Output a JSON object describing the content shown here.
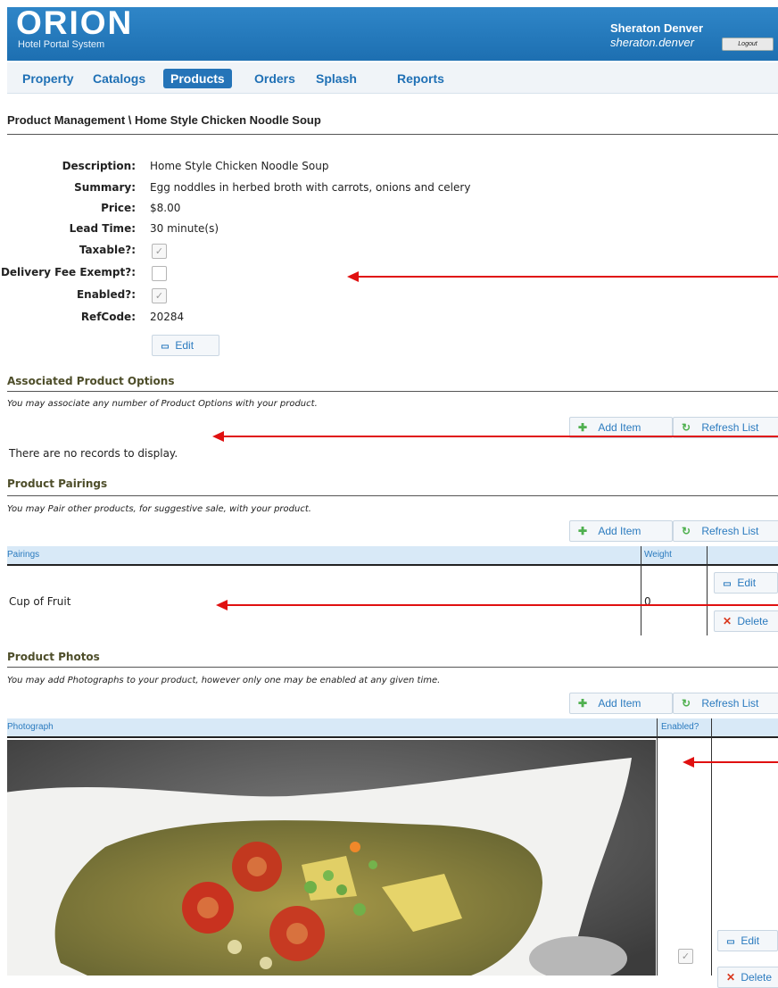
{
  "header": {
    "logo": "ORION",
    "logo_subtitle": "Hotel Portal System",
    "hotel_name": "Sheraton Denver",
    "username": "sheraton.denver",
    "logout_label": "Logout"
  },
  "nav": {
    "items": [
      {
        "label": "Property"
      },
      {
        "label": "Catalogs"
      },
      {
        "label": "Products",
        "active": true
      },
      {
        "label": "Orders"
      },
      {
        "label": "Splash"
      },
      {
        "label": "Reports"
      }
    ]
  },
  "breadcrumb": "Product Management \\ Home Style Chicken Noodle Soup",
  "product": {
    "description_label": "Description:",
    "description": "Home Style Chicken Noodle Soup",
    "summary_label": "Summary:",
    "summary": "Egg noddles in herbed broth with carrots, onions and celery",
    "price_label": "Price:",
    "price": "$8.00",
    "lead_time_label": "Lead Time:",
    "lead_time": "30 minute(s)",
    "taxable_label": "Taxable?:",
    "taxable": true,
    "delivery_fee_exempt_label": "Delivery Fee Exempt?:",
    "delivery_fee_exempt": false,
    "enabled_label": "Enabled?:",
    "enabled": true,
    "refcode_label": "RefCode:",
    "refcode": "20284",
    "edit_label": "Edit"
  },
  "options_section": {
    "title": "Associated Product Options",
    "note": "You may associate any number of Product Options with your product.",
    "add_label": "Add Item",
    "refresh_label": "Refresh List",
    "empty_message": "There are no records to display."
  },
  "pairings_section": {
    "title": "Product Pairings",
    "note": "You may Pair other products, for suggestive sale, with your product.",
    "add_label": "Add Item",
    "refresh_label": "Refresh List",
    "columns": [
      "Pairings",
      "Weight"
    ],
    "rows": [
      {
        "name": "Cup of Fruit",
        "weight": "0",
        "edit_label": "Edit",
        "delete_label": "Delete"
      }
    ]
  },
  "photos_section": {
    "title": "Product Photos",
    "note": "You may add Photographs to your product, however only one may be enabled at any given time.",
    "add_label": "Add Item",
    "refresh_label": "Refresh List",
    "columns": [
      "Photograph",
      "Enabled?"
    ],
    "rows": [
      {
        "enabled": true,
        "edit_label": "Edit",
        "delete_label": "Delete"
      }
    ]
  },
  "colors": {
    "header_blue": "#1d6fb1",
    "nav_text": "#1f70b5",
    "link_blue": "#2b7bbf",
    "grid_header_bg": "#d8e9f7",
    "annotation_arrow": "#e01010"
  },
  "icons": {
    "edit": "edit-icon",
    "add": "add-icon",
    "refresh": "refresh-icon",
    "delete": "delete-icon"
  }
}
